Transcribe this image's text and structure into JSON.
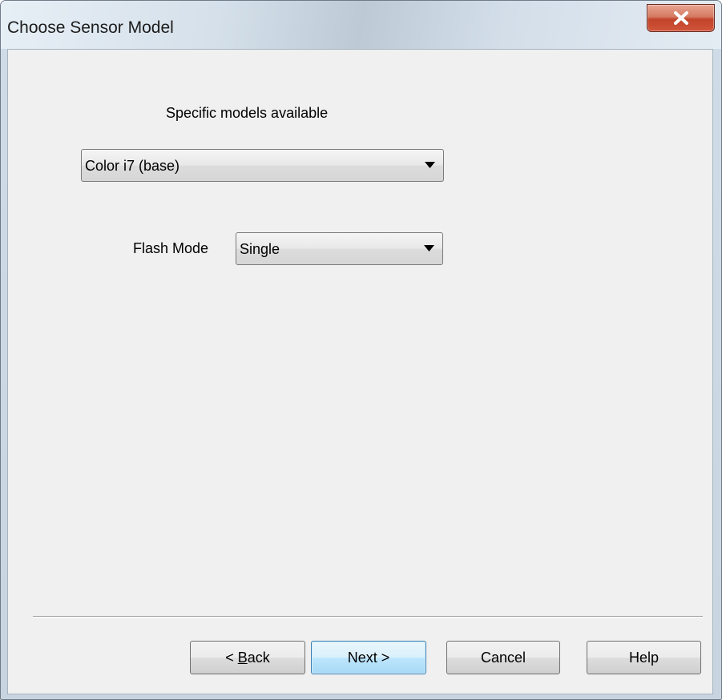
{
  "window": {
    "title": "Choose Sensor Model"
  },
  "titlebar": {
    "close_icon": "close-icon"
  },
  "form": {
    "models_label": "Specific models available",
    "model_select": {
      "selected": "Color i7 (base)",
      "icon": "chevron-down-icon"
    },
    "flash_label": "Flash Mode",
    "flash_select": {
      "selected": "Single",
      "icon": "chevron-down-icon"
    }
  },
  "buttons": {
    "back_prefix": "< ",
    "back_mnemonic": "B",
    "back_rest": "ack",
    "next": "Next >",
    "cancel": "Cancel",
    "help": "Help"
  },
  "colors": {
    "close_button": "#c2432a",
    "default_button_border": "#3c7fb1",
    "dialog_background": "#f0f0f0"
  }
}
